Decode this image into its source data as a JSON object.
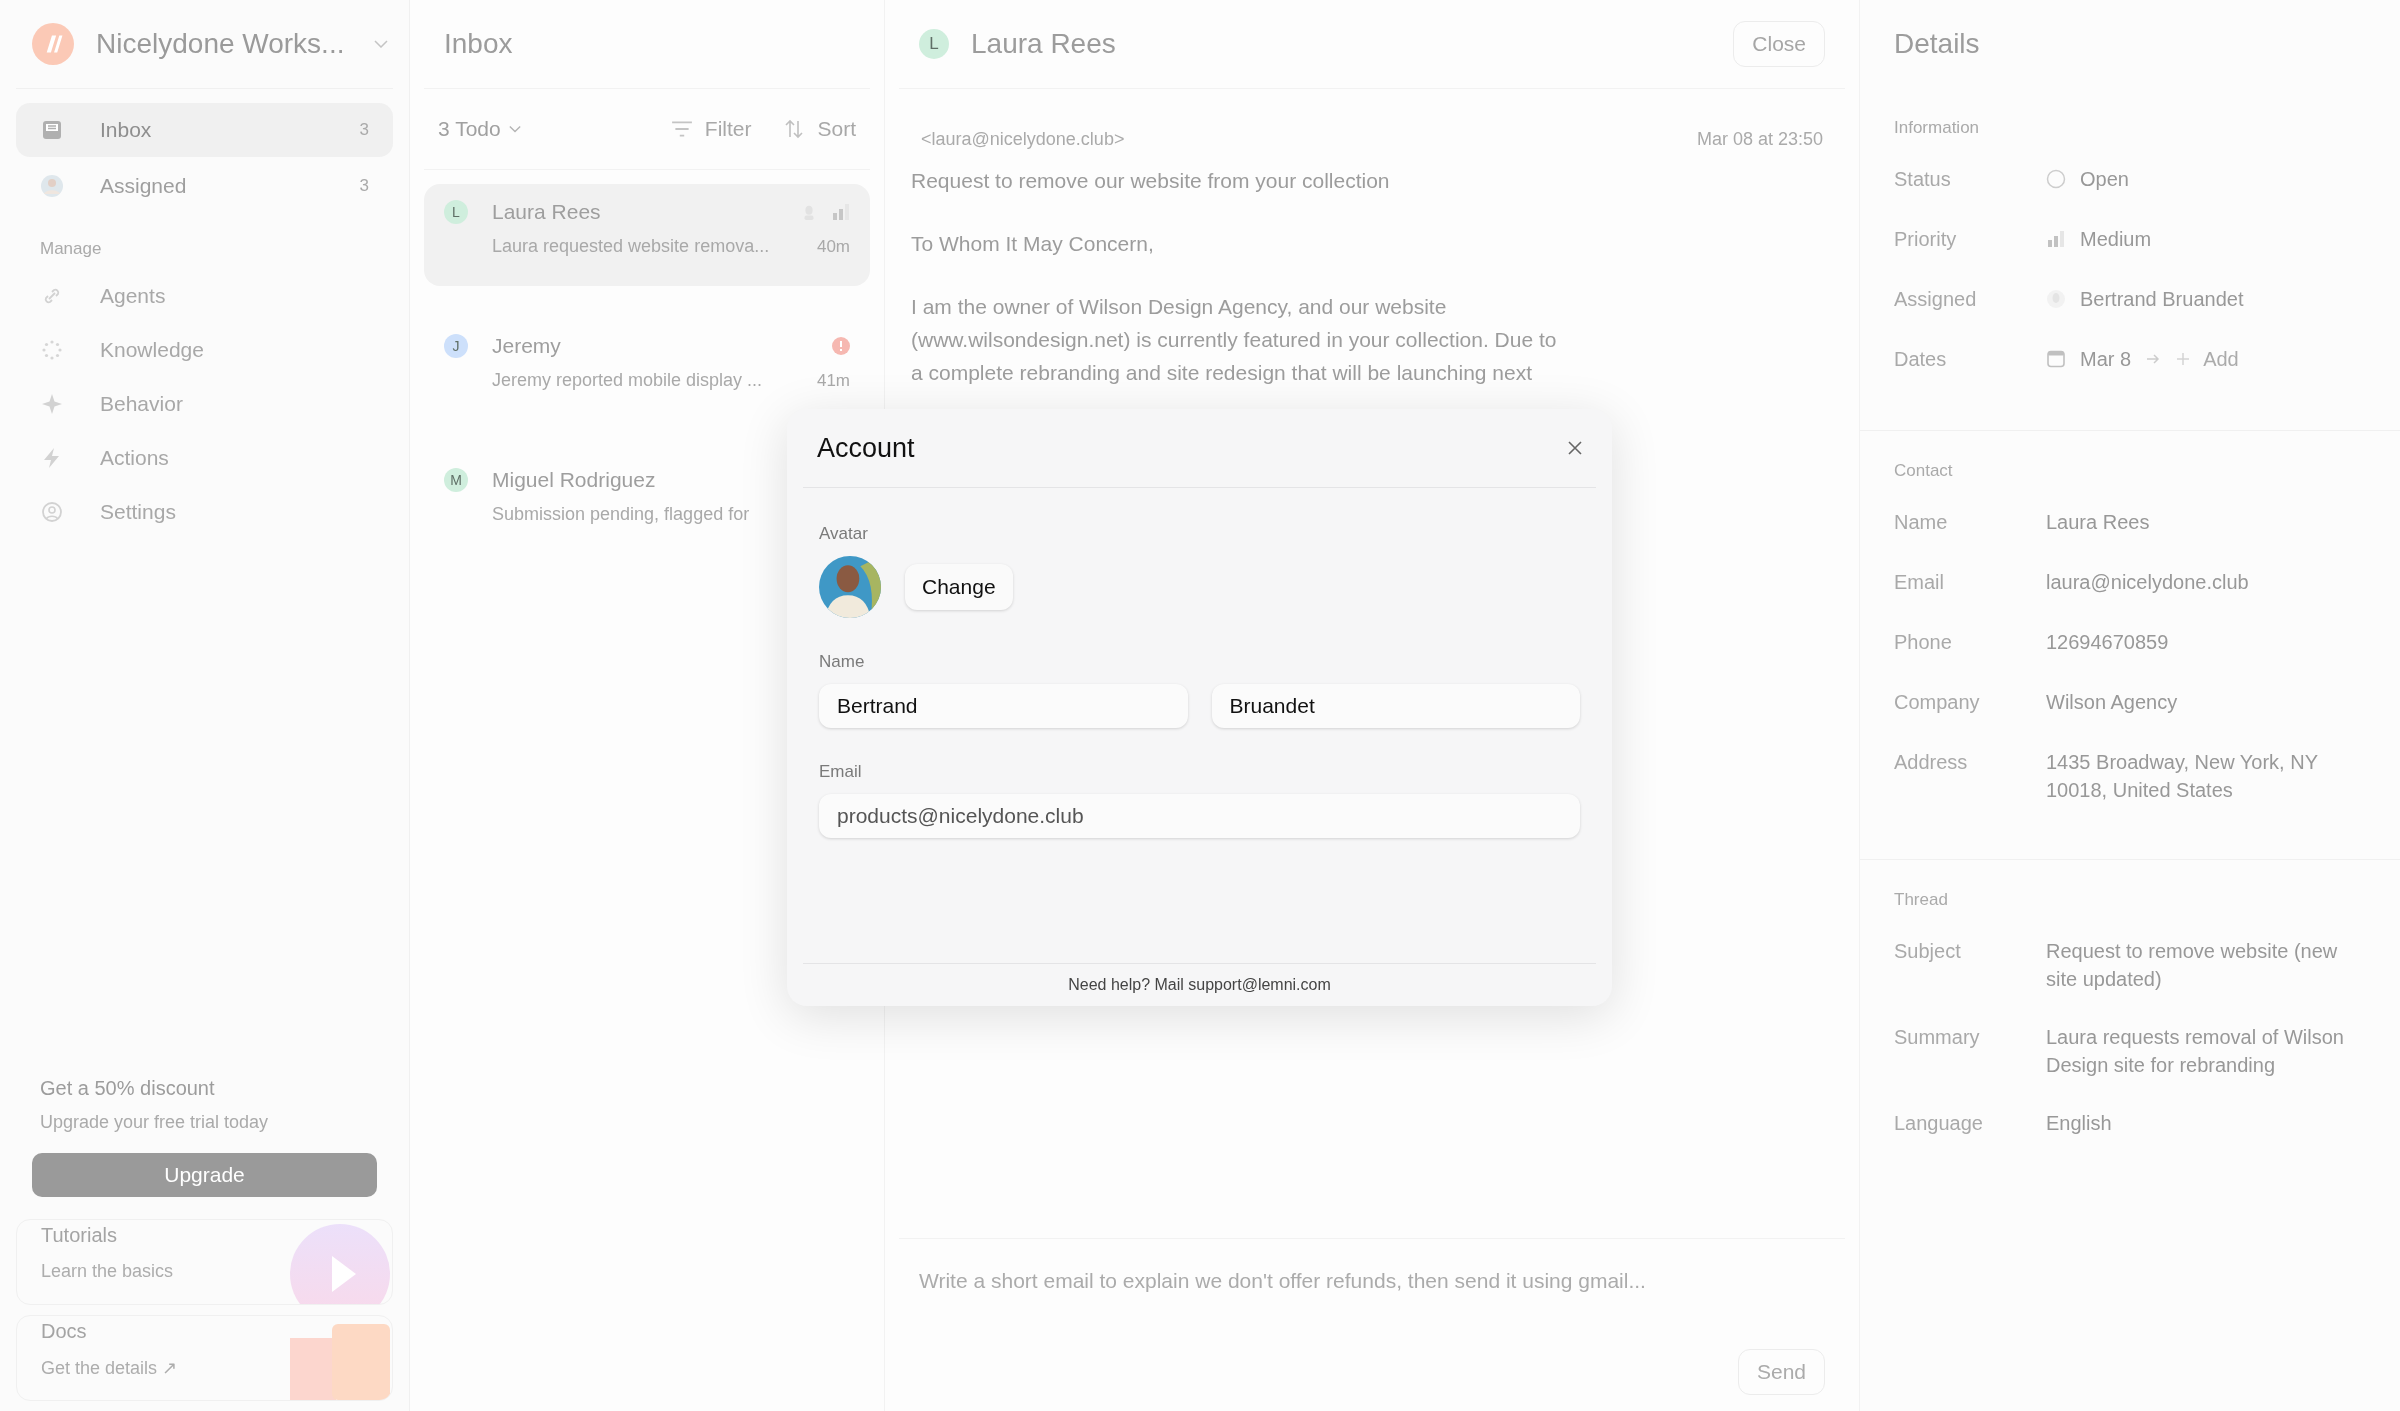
{
  "sidebar": {
    "workspace": "Nicelydone Works...",
    "nav": [
      {
        "label": "Inbox",
        "count": "3",
        "kind": "inbox",
        "selected": true
      },
      {
        "label": "Assigned",
        "count": "3",
        "kind": "avatar",
        "selected": false
      }
    ],
    "section": "Manage",
    "manage": [
      {
        "label": "Agents",
        "kind": "link"
      },
      {
        "label": "Knowledge",
        "kind": "dots"
      },
      {
        "label": "Behavior",
        "kind": "sparkle"
      },
      {
        "label": "Actions",
        "kind": "bolt"
      },
      {
        "label": "Settings",
        "kind": "gear"
      }
    ],
    "promo": {
      "title": "Get a 50% discount",
      "subtitle": "Upgrade your free trial today",
      "button": "Upgrade"
    },
    "cards": [
      {
        "title": "Tutorials",
        "subtitle": "Learn the basics",
        "kind": "video"
      },
      {
        "title": "Docs",
        "subtitle": "Get the details ↗",
        "kind": "docs"
      }
    ]
  },
  "inbox": {
    "title": "Inbox",
    "todo": "3 Todo",
    "filter": "Filter",
    "sort": "Sort",
    "conversations": [
      {
        "initial": "L",
        "name": "Laura Rees",
        "preview": "Laura requested website remova...",
        "time": "40m",
        "color": "#cfeedd",
        "kind": "priority",
        "selected": true
      },
      {
        "initial": "J",
        "name": "Jeremy",
        "preview": "Jeremy reported mobile display ...",
        "time": "41m",
        "color": "#cde0fb",
        "kind": "alert",
        "selected": false
      },
      {
        "initial": "M",
        "name": "Miguel Rodriguez",
        "preview": "Submission pending, flagged for",
        "color": "#cfeedd",
        "kind": "plain",
        "selected": false
      }
    ]
  },
  "message": {
    "initial": "L",
    "name": "Laura Rees",
    "color": "#cfeedd",
    "close": "Close",
    "from": "<laura@nicelydone.club>",
    "date": "Mar 08 at 23:50",
    "subject": "Request to remove our website from your collection",
    "greeting": "To Whom It May Concern,",
    "body": "I am the owner of Wilson Design Agency, and our website (www.wilsondesign.net) is currently featured in your collection. Due to a complete rebranding and site redesign that will be launching next",
    "composer": {
      "placeholder": "Write a short email to explain we don't offer refunds, then send it using gmail..."
    },
    "send": "Send"
  },
  "details": {
    "title": "Details",
    "sections": [
      {
        "title": "Information",
        "rows": [
          {
            "label": "Status",
            "value": "Open",
            "kind": "status"
          },
          {
            "label": "Priority",
            "value": "Medium",
            "kind": "priority"
          },
          {
            "label": "Assigned",
            "value": "Bertrand Bruandet",
            "kind": "person"
          },
          {
            "label": "Dates",
            "value": "Mar 8",
            "add": "Add",
            "kind": "date"
          }
        ]
      },
      {
        "title": "Contact",
        "rows": [
          {
            "label": "Name",
            "value": "Laura Rees",
            "kind": "text"
          },
          {
            "label": "Email",
            "value": "laura@nicelydone.club",
            "kind": "text"
          },
          {
            "label": "Phone",
            "value": "12694670859",
            "kind": "text"
          },
          {
            "label": "Company",
            "value": "Wilson Agency",
            "kind": "text"
          },
          {
            "label": "Address",
            "value": "1435 Broadway, New York, NY 10018, United States",
            "kind": "text"
          }
        ]
      },
      {
        "title": "Thread",
        "rows": [
          {
            "label": "Subject",
            "value": "Request to remove website (new site updated)",
            "kind": "text"
          },
          {
            "label": "Summary",
            "value": "Laura requests removal of Wilson Design site for rebranding",
            "kind": "text"
          },
          {
            "label": "Language",
            "value": "English",
            "kind": "text"
          }
        ]
      }
    ]
  },
  "modal": {
    "title": "Account",
    "avatar_label": "Avatar",
    "change": "Change",
    "name_label": "Name",
    "first_name": "Bertrand",
    "last_name": "Bruandet",
    "email_label": "Email",
    "email": "products@nicelydone.club",
    "help": "Need help? Mail support@lemni.com"
  }
}
